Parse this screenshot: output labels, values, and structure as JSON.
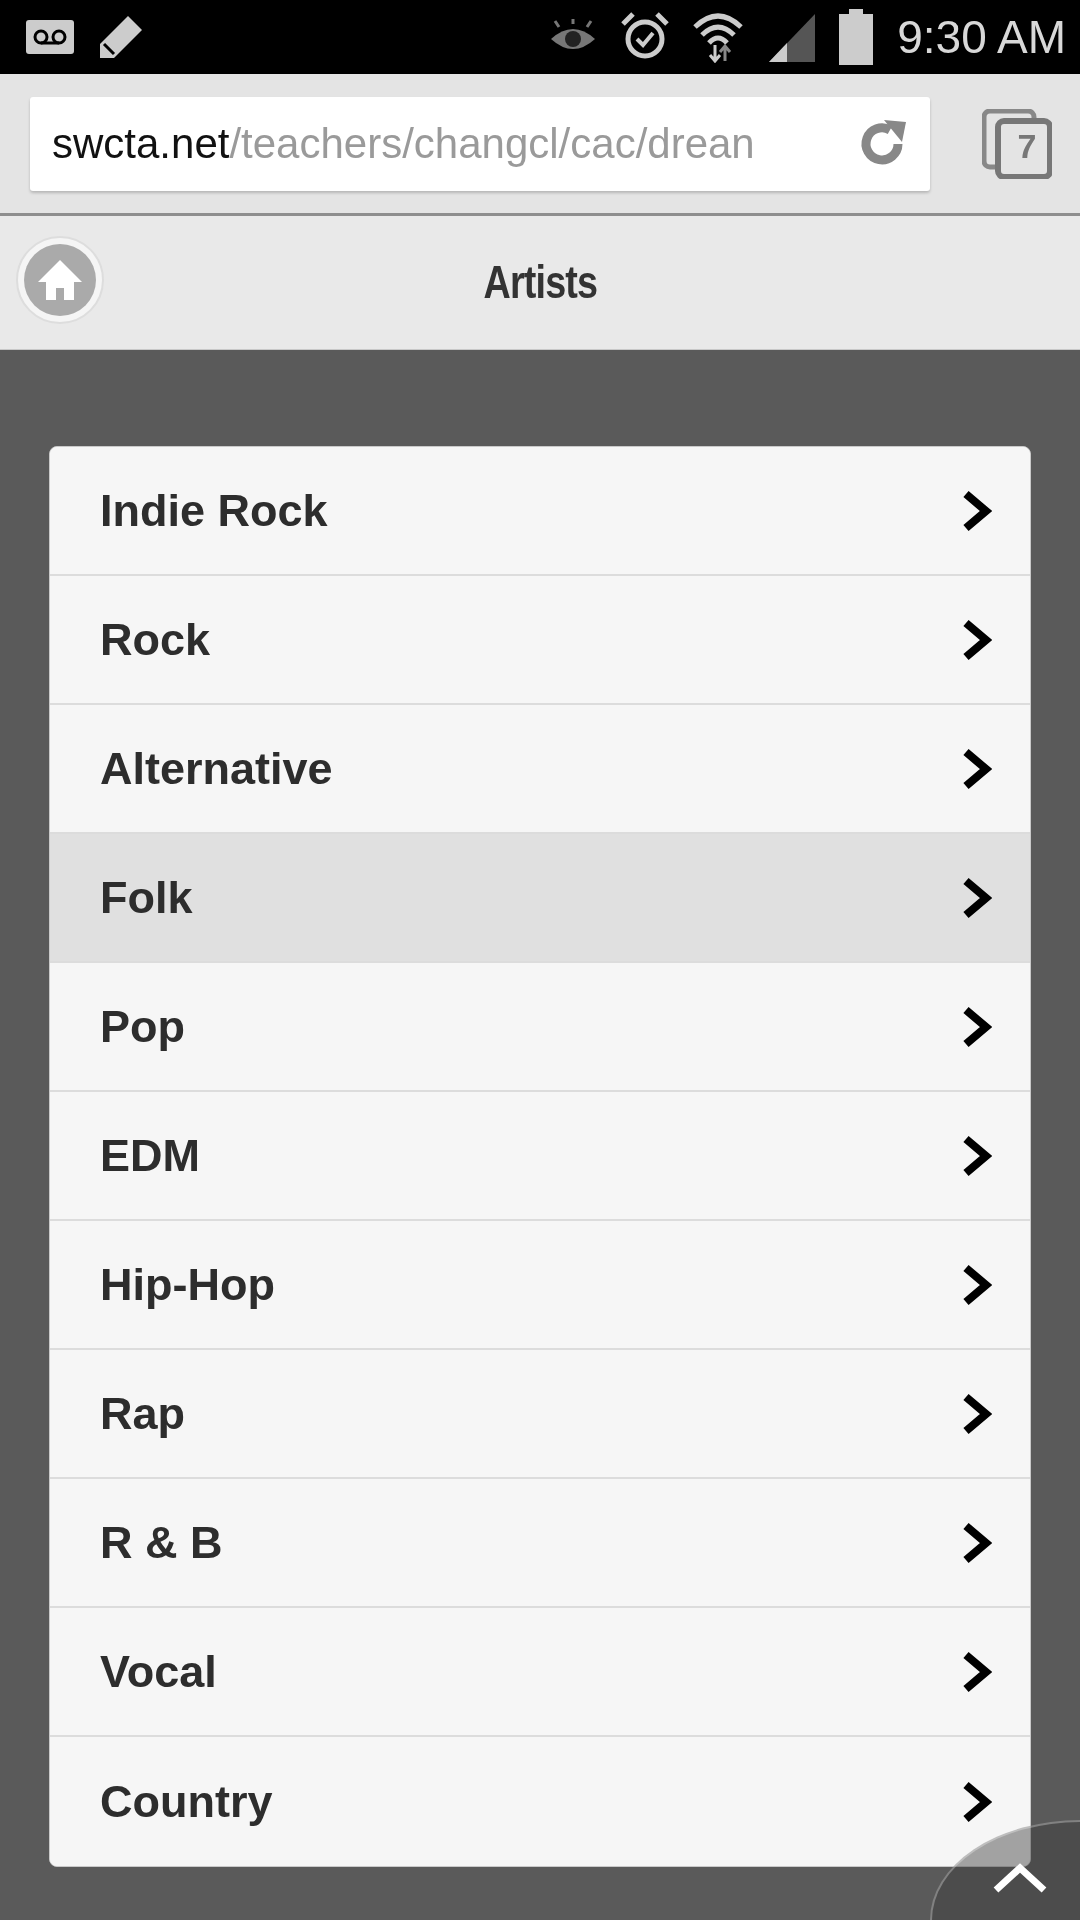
{
  "status_bar": {
    "time": "9:30 AM"
  },
  "browser": {
    "url_host": "swcta.net",
    "url_path": "/teachers/changcl/cac/drean",
    "tab_count": "7"
  },
  "header": {
    "title": "Artists"
  },
  "genres": [
    {
      "label": "Indie Rock",
      "selected": false
    },
    {
      "label": "Rock",
      "selected": false
    },
    {
      "label": "Alternative",
      "selected": false
    },
    {
      "label": "Folk",
      "selected": true
    },
    {
      "label": "Pop",
      "selected": false
    },
    {
      "label": "EDM",
      "selected": false
    },
    {
      "label": "Hip-Hop",
      "selected": false
    },
    {
      "label": "Rap",
      "selected": false
    },
    {
      "label": "R & B",
      "selected": false
    },
    {
      "label": "Vocal",
      "selected": false
    },
    {
      "label": "Country",
      "selected": false
    }
  ]
}
